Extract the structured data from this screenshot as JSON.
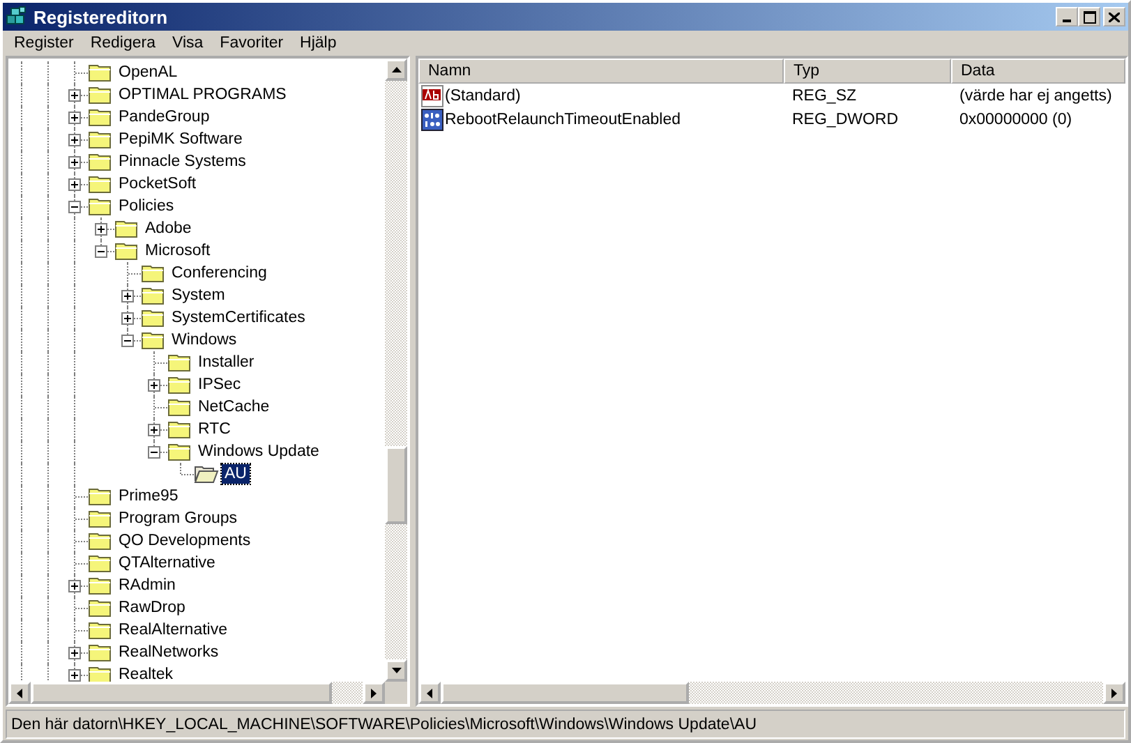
{
  "window": {
    "title": "Registereditorn"
  },
  "menu": [
    "Register",
    "Redigera",
    "Visa",
    "Favoriter",
    "Hjälp"
  ],
  "tree": [
    {
      "label": "OpenAL",
      "selected": false
    },
    {
      "label": "OPTIMAL PROGRAMS",
      "expanded": false,
      "selected": false
    },
    {
      "label": "PandeGroup",
      "expanded": false,
      "selected": false
    },
    {
      "label": "PepiMK Software",
      "expanded": false,
      "selected": false
    },
    {
      "label": "Pinnacle Systems",
      "expanded": false,
      "selected": false
    },
    {
      "label": "PocketSoft",
      "expanded": false,
      "selected": false
    },
    {
      "label": "Policies",
      "expanded": true,
      "selected": false,
      "children": [
        {
          "label": "Adobe",
          "expanded": false,
          "selected": false
        },
        {
          "label": "Microsoft",
          "expanded": true,
          "selected": false,
          "children": [
            {
              "label": "Conferencing",
              "selected": false
            },
            {
              "label": "System",
              "expanded": false,
              "selected": false
            },
            {
              "label": "SystemCertificates",
              "expanded": false,
              "selected": false
            },
            {
              "label": "Windows",
              "expanded": true,
              "selected": false,
              "children": [
                {
                  "label": "Installer",
                  "selected": false
                },
                {
                  "label": "IPSec",
                  "expanded": false,
                  "selected": false
                },
                {
                  "label": "NetCache",
                  "selected": false
                },
                {
                  "label": "RTC",
                  "expanded": false,
                  "selected": false
                },
                {
                  "label": "Windows Update",
                  "expanded": true,
                  "selected": false,
                  "children": [
                    {
                      "label": "AU",
                      "selected": true
                    }
                  ]
                }
              ]
            }
          ]
        }
      ]
    },
    {
      "label": "Prime95",
      "selected": false
    },
    {
      "label": "Program Groups",
      "selected": false
    },
    {
      "label": "QO Developments",
      "selected": false
    },
    {
      "label": "QTAlternative",
      "selected": false
    },
    {
      "label": "RAdmin",
      "expanded": false,
      "selected": false
    },
    {
      "label": "RawDrop",
      "selected": false
    },
    {
      "label": "RealAlternative",
      "selected": false
    },
    {
      "label": "RealNetworks",
      "expanded": false,
      "selected": false
    },
    {
      "label": "Realtek",
      "expanded": false,
      "selected": false
    }
  ],
  "values": {
    "columns": [
      "Namn",
      "Typ",
      "Data"
    ],
    "rows": [
      {
        "kind": "string",
        "name": "(Standard)",
        "type": "REG_SZ",
        "data": "(värde har ej angetts)"
      },
      {
        "kind": "dword",
        "name": "RebootRelaunchTimeoutEnabled",
        "type": "REG_DWORD",
        "data": "0x00000000 (0)"
      }
    ]
  },
  "status_bar": "Den här datorn\\HKEY_LOCAL_MACHINE\\SOFTWARE\\Policies\\Microsoft\\Windows\\Windows Update\\AU"
}
